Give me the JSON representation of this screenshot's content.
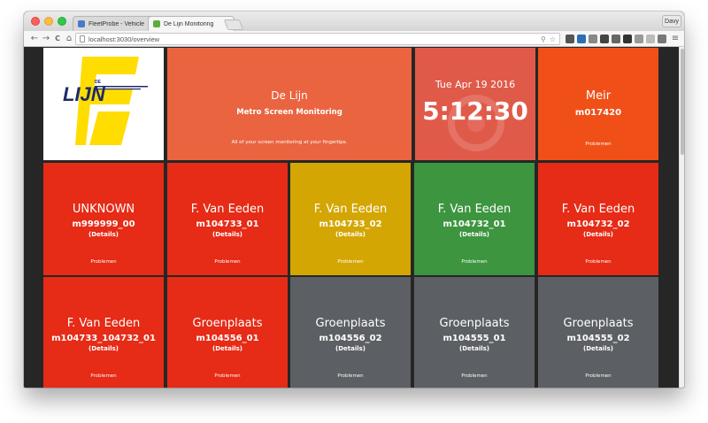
{
  "browser": {
    "tabs": [
      {
        "title": "FleetProbe - Vehicle Diagn",
        "close": "×",
        "icon_color": "#4a79c6"
      },
      {
        "title": "De Lijn Monitoring",
        "close": "×",
        "icon_color": "#5dae3b"
      }
    ],
    "profile": "Davy",
    "url": "localhost:3030/overview",
    "nav": {
      "back": "←",
      "forward": "→",
      "reload": "C",
      "home": "⌂"
    }
  },
  "logo": {
    "top_text": "DE",
    "brand": "LIJN",
    "brand_color": "#ffdd00"
  },
  "header": {
    "title": "De Lijn",
    "subtitle": "Metro Screen Monitoring",
    "tagline": "All of your screen monitoring at your fingertips."
  },
  "clock": {
    "date": "Tue Apr 19 2016",
    "time": "5:12:30"
  },
  "meir": {
    "location": "Meir",
    "code": "m017420",
    "status": "Problemen"
  },
  "screens": [
    {
      "location": "UNKNOWN",
      "code": "m999999_00",
      "details": "(Details)",
      "status": "Problemen",
      "color": "red"
    },
    {
      "location": "F. Van Eeden",
      "code": "m104733_01",
      "details": "(Details)",
      "status": "Problemen",
      "color": "red"
    },
    {
      "location": "F. Van Eeden",
      "code": "m104733_02",
      "details": "(Details)",
      "status": "Problemen",
      "color": "yellow"
    },
    {
      "location": "F. Van Eeden",
      "code": "m104732_01",
      "details": "(Details)",
      "status": "Problemen",
      "color": "green"
    },
    {
      "location": "F. Van Eeden",
      "code": "m104732_02",
      "details": "(Details)",
      "status": "Problemen",
      "color": "red"
    },
    {
      "location": "F. Van Eeden",
      "code": "m104733_104732_01",
      "details": "(Details)",
      "status": "Problemen",
      "color": "red"
    },
    {
      "location": "Groenplaats",
      "code": "m104556_01",
      "details": "(Details)",
      "status": "Problemen",
      "color": "red"
    },
    {
      "location": "Groenplaats",
      "code": "m104556_02",
      "details": "(Details)",
      "status": "Problemen",
      "color": "grey"
    },
    {
      "location": "Groenplaats",
      "code": "m104555_01",
      "details": "(Details)",
      "status": "Problemen",
      "color": "grey"
    },
    {
      "location": "Groenplaats",
      "code": "m104555_02",
      "details": "(Details)",
      "status": "Problemen",
      "color": "grey"
    }
  ],
  "colors": {
    "red": "#e62b16",
    "yellow": "#d4a603",
    "green": "#3d9540",
    "grey": "#5c6064",
    "header": "#ea6440",
    "clock": "#e05a4a",
    "meir": "#f05018"
  }
}
